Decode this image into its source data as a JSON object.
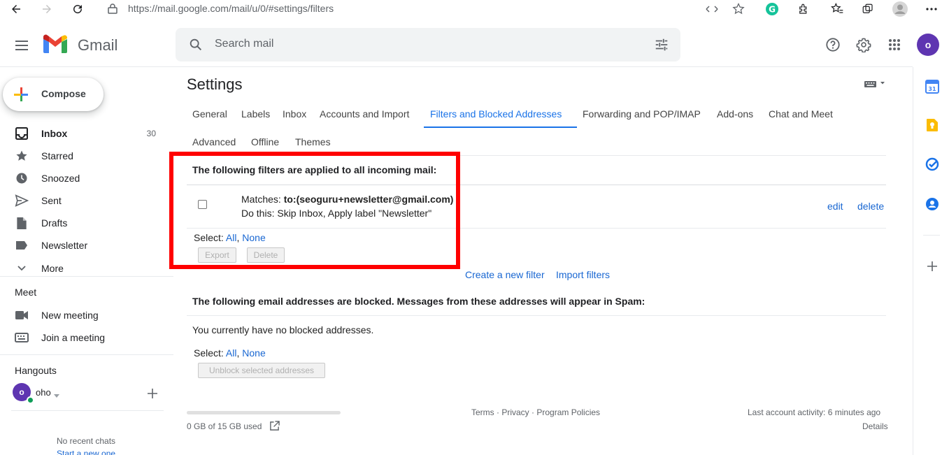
{
  "browser": {
    "url": "https://mail.google.com/mail/u/0/#settings/filters"
  },
  "header": {
    "app_name": "Gmail",
    "search_placeholder": "Search mail",
    "avatar_letter": "o"
  },
  "sidebar": {
    "compose_label": "Compose",
    "items": [
      {
        "label": "Inbox",
        "count": "30",
        "icon": "inbox-icon"
      },
      {
        "label": "Starred",
        "icon": "star-icon"
      },
      {
        "label": "Snoozed",
        "icon": "clock-icon"
      },
      {
        "label": "Sent",
        "icon": "send-icon"
      },
      {
        "label": "Drafts",
        "icon": "draft-icon"
      },
      {
        "label": "Newsletter",
        "icon": "label-icon"
      },
      {
        "label": "More",
        "icon": "chevron-down-icon"
      }
    ],
    "meet": {
      "title": "Meet",
      "new_meeting": "New meeting",
      "join_meeting": "Join a meeting"
    },
    "hangouts": {
      "title": "Hangouts",
      "user_letter": "o",
      "user_name": "oho",
      "no_chats": "No recent chats",
      "start_chat": "Start a new one"
    }
  },
  "settings": {
    "title": "Settings",
    "tabs": [
      {
        "label": "General"
      },
      {
        "label": "Labels"
      },
      {
        "label": "Inbox"
      },
      {
        "label": "Accounts and Import"
      },
      {
        "label": "Filters and Blocked Addresses",
        "active": true
      },
      {
        "label": "Forwarding and POP/IMAP"
      },
      {
        "label": "Add-ons"
      },
      {
        "label": "Chat and Meet"
      },
      {
        "label": "Advanced"
      },
      {
        "label": "Offline"
      },
      {
        "label": "Themes"
      }
    ],
    "filters": {
      "heading": "The following filters are applied to all incoming mail:",
      "matches_prefix": "Matches: ",
      "matches_value": "to:(seoguru+newsletter@gmail.com)",
      "action": "Do this: Skip Inbox, Apply label \"Newsletter\"",
      "edit": "edit",
      "delete": "delete",
      "select_label": "Select: ",
      "select_all": "All",
      "select_sep": ", ",
      "select_none": "None",
      "export_btn": "Export",
      "delete_btn": "Delete",
      "create_filter": "Create a new filter",
      "import_filters": "Import filters"
    },
    "blocked": {
      "heading": "The following email addresses are blocked. Messages from these addresses will appear in Spam:",
      "empty": "You currently have no blocked addresses.",
      "select_label": "Select: ",
      "select_all": "All",
      "select_sep": ", ",
      "select_none": "None",
      "unblock_btn": "Unblock selected addresses"
    }
  },
  "footer": {
    "storage": "0 GB of 15 GB used",
    "terms": "Terms",
    "privacy": "Privacy",
    "policies": "Program Policies",
    "sep": " · ",
    "last_activity": "Last account activity: 6 minutes ago",
    "details": "Details"
  },
  "colors": {
    "accent": "#1a73e8",
    "highlight": "#ff0000",
    "avatar": "#5e35b1"
  }
}
